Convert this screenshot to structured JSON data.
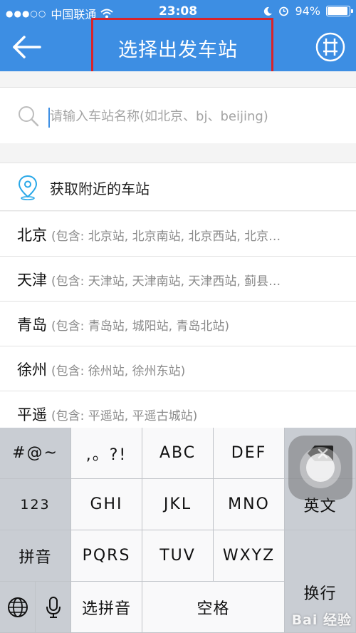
{
  "status_bar": {
    "carrier": "中国联通",
    "time": "23:08",
    "battery": "94%",
    "battery_level": 0.94
  },
  "nav": {
    "title": "选择出发车站",
    "back_icon": "arrow-left-icon",
    "map_icon": "map-grid-icon"
  },
  "search": {
    "placeholder": "请输入车站名称(如北京、bj、beijing)"
  },
  "nearby": {
    "label": "获取附近的车站"
  },
  "stations": [
    {
      "name": "北京",
      "detail": "(包含: 北京站, 北京南站, 北京西站, 北京…"
    },
    {
      "name": "天津",
      "detail": "(包含: 天津站, 天津南站, 天津西站, 蓟县…"
    },
    {
      "name": "青岛",
      "detail": "(包含: 青岛站, 城阳站, 青岛北站)"
    },
    {
      "name": "徐州",
      "detail": "(包含: 徐州站, 徐州东站)"
    },
    {
      "name": "平遥",
      "detail": "(包含: 平遥站, 平遥古城站)"
    }
  ],
  "keyboard": {
    "symbols": "#@~",
    "punct": ",。?!",
    "abc": "ABC",
    "def": "DEF",
    "num": "123",
    "ghi": "GHI",
    "jkl": "JKL",
    "mno": "MNO",
    "english": "英文",
    "pinyin": "拼音",
    "pqrs": "PQRS",
    "tuv": "TUV",
    "wxyz": "WXYZ",
    "newline": "换行",
    "select_pinyin": "选拼音",
    "space": "空格"
  },
  "watermark": "Bai 经验",
  "colors": {
    "nav_bg": "#3d8ee3",
    "highlight_border": "#d8232a"
  }
}
